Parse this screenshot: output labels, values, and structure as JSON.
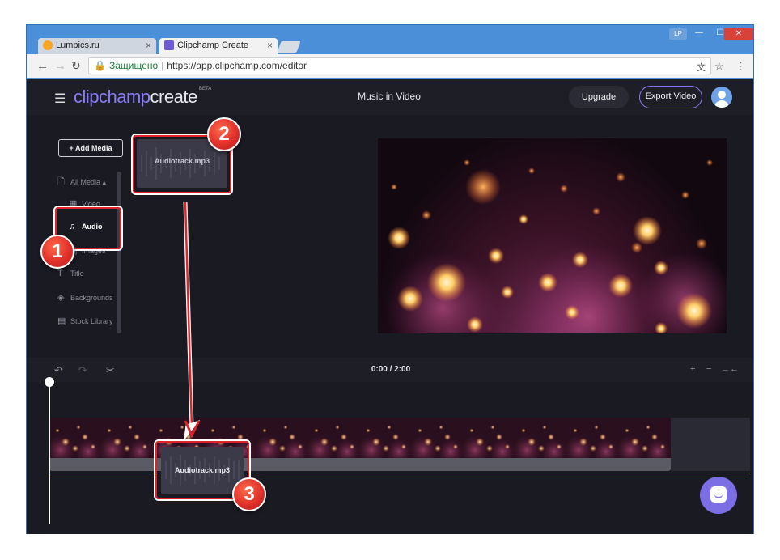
{
  "browser": {
    "tabs": [
      {
        "title": "Lumpics.ru",
        "favicon_color": "#f6a623"
      },
      {
        "title": "Clipchamp Create",
        "favicon_color": "#6f5bd6"
      }
    ],
    "profile_badge": "LP",
    "controls": {
      "minimize": "—",
      "maximize": "☐",
      "close": "✕"
    },
    "secure_label": "Защищено",
    "url": "https://app.clipchamp.com/editor"
  },
  "app": {
    "logo_main": "clipchamp",
    "logo_create": "create",
    "beta": "BETA",
    "project_title": "Music in Video",
    "upgrade_label": "Upgrade",
    "export_label": "Export Video",
    "add_media_label": "+ Add Media",
    "sidebar": [
      {
        "label": "All Media ▴",
        "icon": "file-icon"
      },
      {
        "label": "Video",
        "icon": "film-icon"
      },
      {
        "label": "Audio",
        "icon": "music-note-icon",
        "active": true
      },
      {
        "label": "Images",
        "icon": "image-icon"
      },
      {
        "label": "Title",
        "icon": "text-icon"
      },
      {
        "label": "Backgrounds",
        "icon": "layers-icon"
      },
      {
        "label": "Stock Library",
        "icon": "store-icon"
      }
    ],
    "media_item_label": "Audiotrack.mp3",
    "timecode": "0:00 / 2:00",
    "audio_clip_label": "Audiotrack.mp3"
  },
  "annotations": {
    "step1": "1",
    "step2": "2",
    "step3": "3",
    "color": "#e0232a"
  }
}
